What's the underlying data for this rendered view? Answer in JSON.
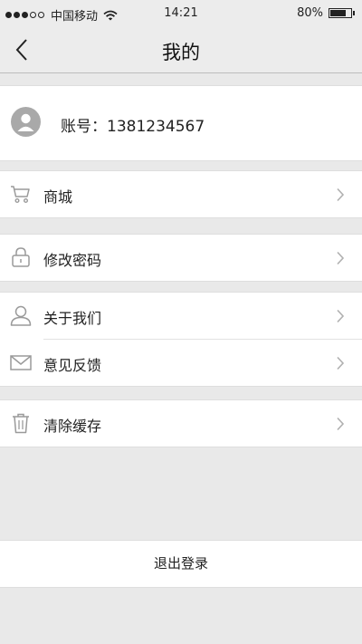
{
  "status_bar": {
    "carrier": "中国移动",
    "time": "14:21",
    "battery": "80%",
    "battery_level": 0.8,
    "signal_bars": 3,
    "signal_total": 5
  },
  "nav": {
    "title": "我的",
    "back_icon": "chevron-left-icon"
  },
  "profile": {
    "avatar_icon": "user-avatar-icon",
    "account": "账号：1381234567"
  },
  "menu_groups": [
    [
      {
        "label": "商城",
        "icon": "cart-icon"
      }
    ],
    [
      {
        "label": "修改密码",
        "icon": "lock-icon"
      }
    ],
    [
      {
        "label": "关于我们",
        "icon": "person-icon"
      },
      {
        "label": "意见反馈",
        "icon": "mail-icon"
      }
    ],
    [
      {
        "label": "清除缓存",
        "icon": "trash-icon"
      }
    ]
  ],
  "logout_label": "退出登录",
  "colors": {
    "background": "#e9e9e9",
    "card": "#ffffff",
    "icon": "#9a9a9a",
    "chevron": "#b0b0b0"
  }
}
